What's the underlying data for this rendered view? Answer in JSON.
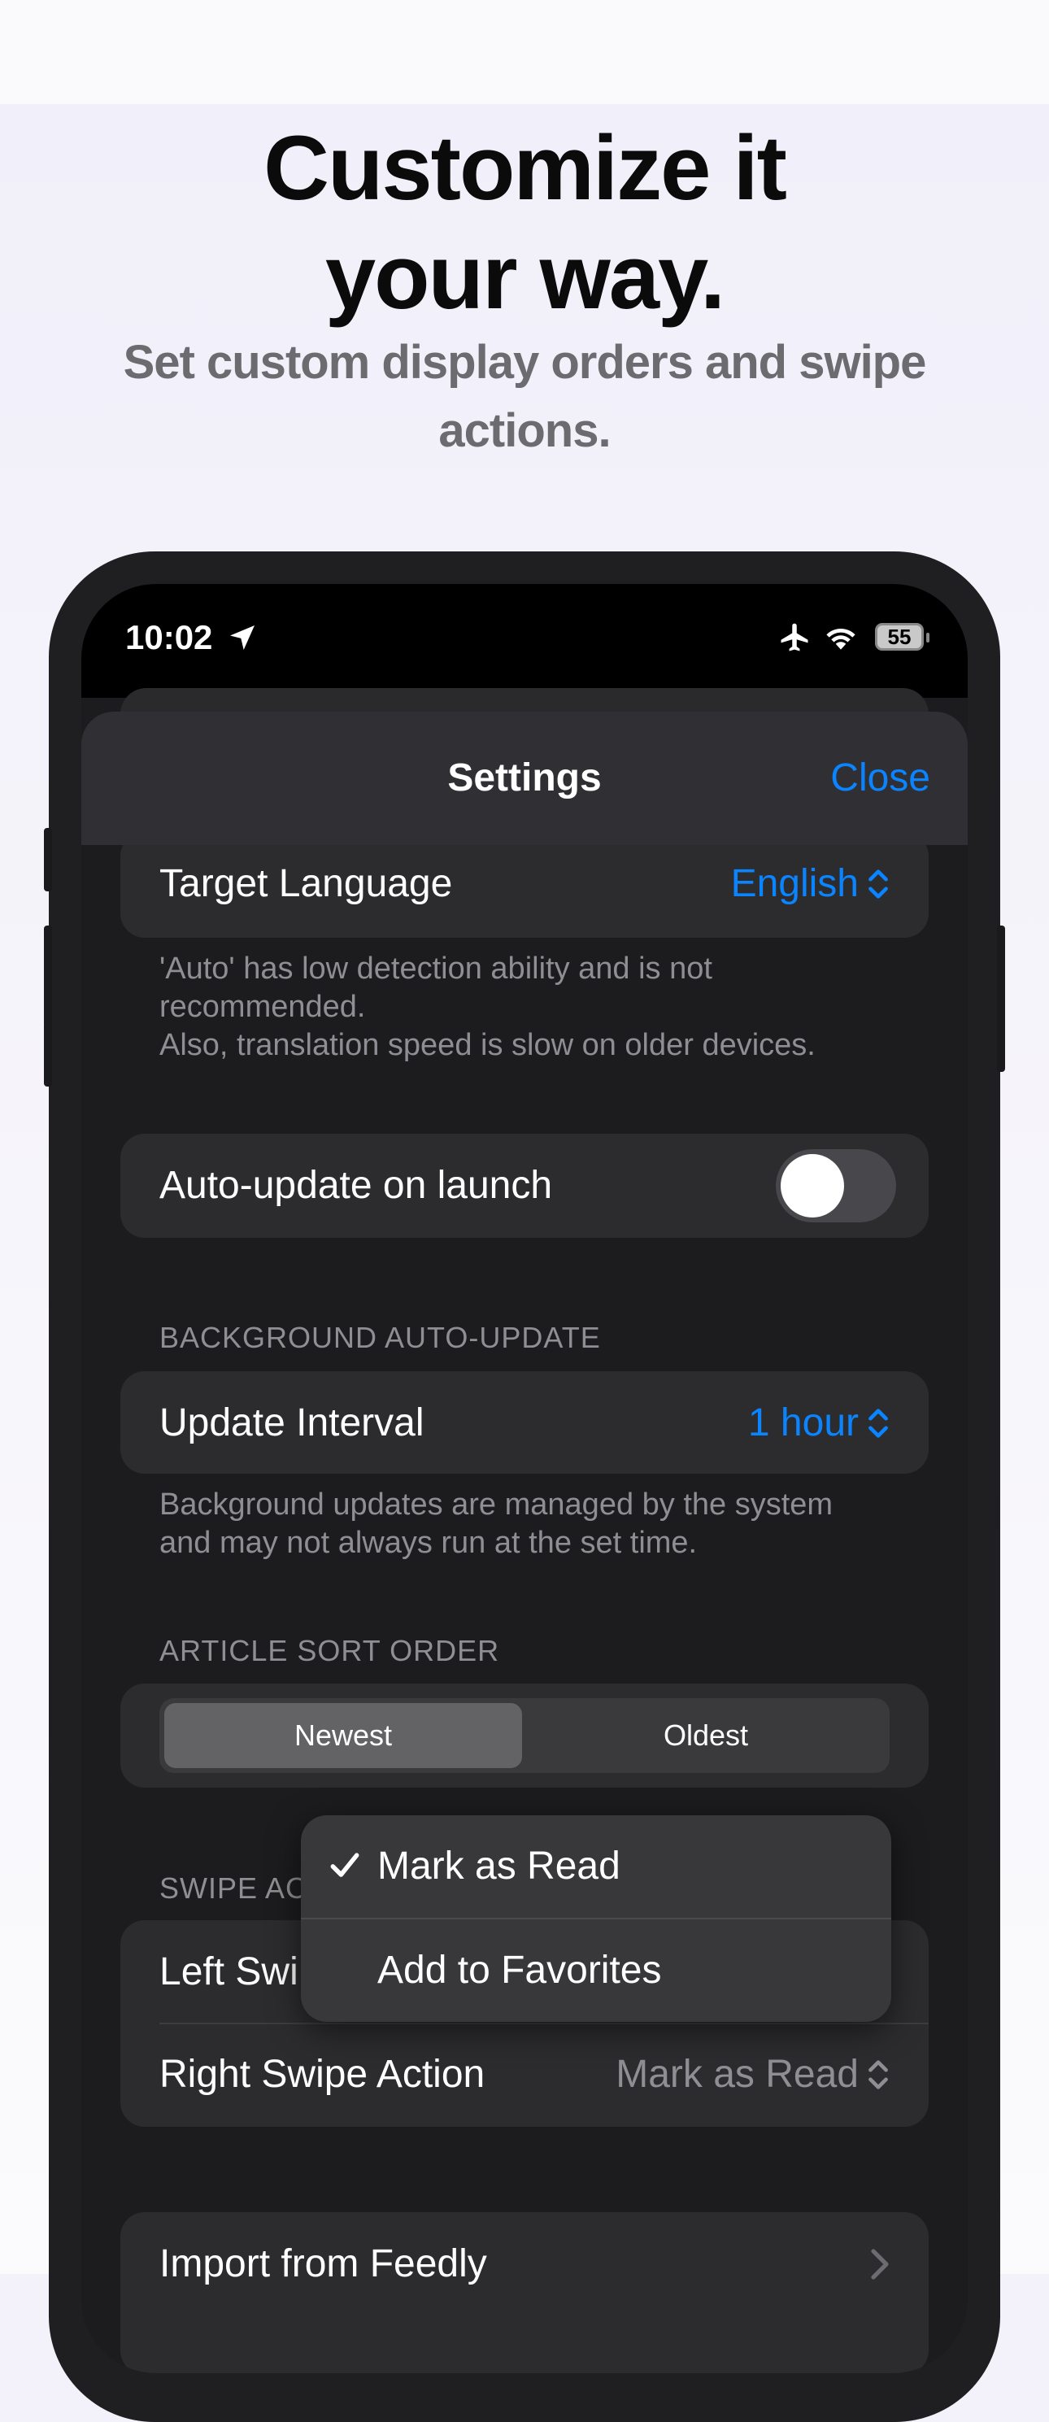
{
  "marketing": {
    "headline_line1": "Customize it",
    "headline_line2": "your way.",
    "subhead": "Set custom display orders and swipe actions."
  },
  "status_bar": {
    "time": "10:02",
    "battery": "55",
    "icons": [
      "location-arrow-icon",
      "airplane-icon",
      "wifi-icon",
      "battery-icon"
    ]
  },
  "nav": {
    "title": "Settings",
    "close_label": "Close"
  },
  "language": {
    "label": "Target Language",
    "value": "English",
    "footer_line1": "'Auto' has low detection ability and is not recommended.",
    "footer_line2": "Also, translation speed is slow on older devices."
  },
  "auto_update": {
    "label": "Auto-update on launch",
    "enabled": false
  },
  "background_update": {
    "header": "BACKGROUND AUTO-UPDATE",
    "label": "Update Interval",
    "value": "1 hour",
    "footer": "Background updates are managed by the system and may not always run at the set time."
  },
  "sort_order": {
    "header": "ARTICLE SORT ORDER",
    "options": [
      "Newest",
      "Oldest"
    ],
    "selected": "Newest"
  },
  "swipe": {
    "header": "SWIPE AC",
    "left_label": "Left Swi",
    "right_label": "Right Swipe Action",
    "right_value": "Mark as Read"
  },
  "swipe_menu": {
    "items": [
      "Mark as Read",
      "Add to Favorites"
    ],
    "checked": "Mark as Read"
  },
  "import": {
    "label": "Import from Feedly"
  },
  "colors": {
    "accent": "#0a84ff",
    "background": "#1c1c1e",
    "cell": "#2c2c2e"
  }
}
